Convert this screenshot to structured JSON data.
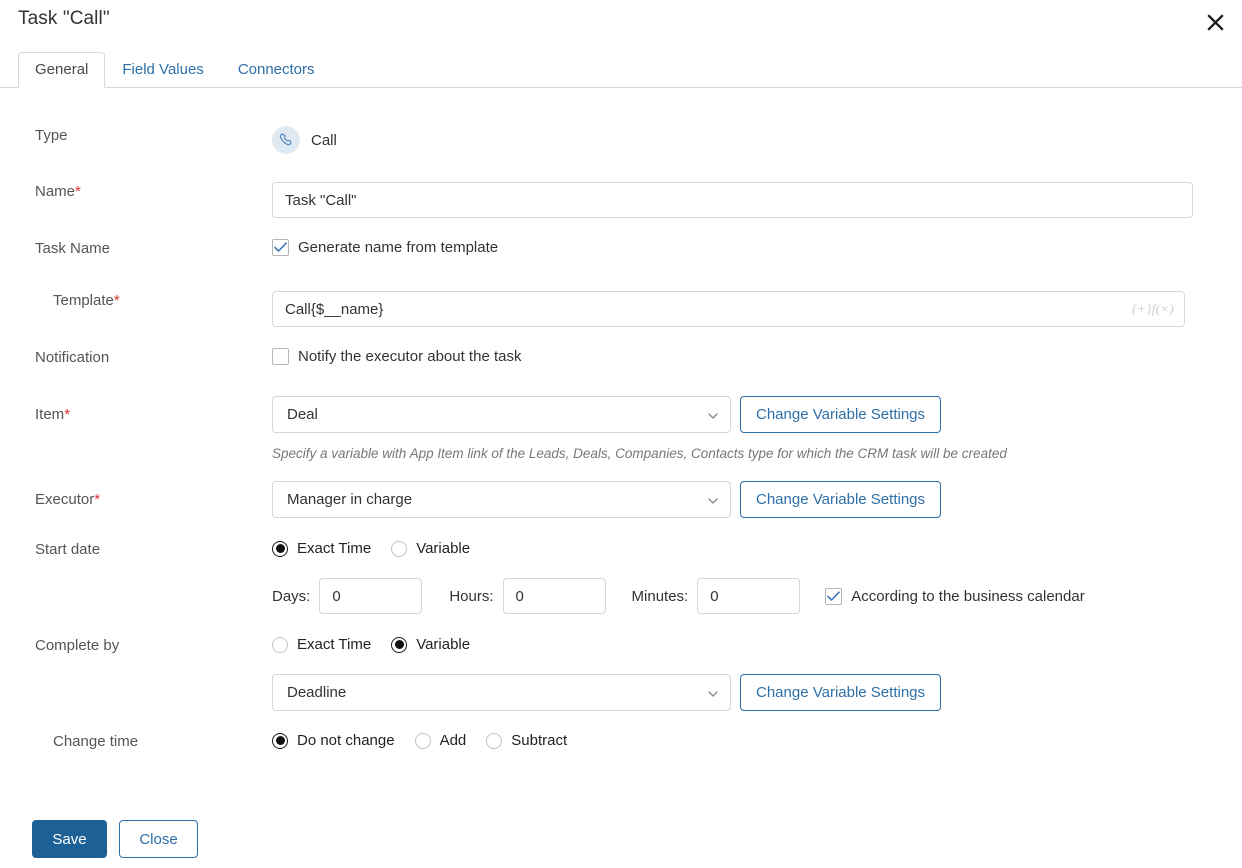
{
  "dialog": {
    "title": "Task \"Call\"",
    "close_icon": "close-icon"
  },
  "tabs": [
    {
      "label": "General",
      "active": true
    },
    {
      "label": "Field Values",
      "active": false
    },
    {
      "label": "Connectors",
      "active": false
    }
  ],
  "form": {
    "type": {
      "label": "Type",
      "icon": "phone-call-icon",
      "value": "Call"
    },
    "name": {
      "label": "Name",
      "required": "*",
      "value": "Task \"Call\"",
      "placeholder": ""
    },
    "task_name": {
      "label": "Task Name",
      "checkbox_label": "Generate name from template",
      "checked": true
    },
    "template": {
      "label": "Template",
      "required": "*",
      "value": "Call{$__name}",
      "fx_badge": "{+}f(×)"
    },
    "notification": {
      "label": "Notification",
      "checkbox_label": "Notify the executor about the task",
      "checked": false
    },
    "item": {
      "label": "Item",
      "required": "*",
      "selected": "Deal",
      "button_label": "Change Variable Settings",
      "hint": "Specify a variable with App Item link of the Leads, Deals, Companies, Contacts type for which the CRM task will be created"
    },
    "executor": {
      "label": "Executor",
      "required": "*",
      "selected": "Manager in charge",
      "button_label": "Change Variable Settings"
    },
    "start_date": {
      "label": "Start date",
      "options": [
        {
          "label": "Exact Time",
          "selected": true
        },
        {
          "label": "Variable",
          "selected": false
        }
      ],
      "days_label": "Days:",
      "days_value": "0",
      "hours_label": "Hours:",
      "hours_value": "0",
      "minutes_label": "Minutes:",
      "minutes_value": "0",
      "business_calendar_label": "According to the business calendar",
      "business_calendar_checked": true
    },
    "complete_by": {
      "label": "Complete by",
      "options": [
        {
          "label": "Exact Time",
          "selected": false
        },
        {
          "label": "Variable",
          "selected": true
        }
      ],
      "selected": "Deadline",
      "button_label": "Change Variable Settings"
    },
    "change_time": {
      "label": "Change time",
      "options": [
        {
          "label": "Do not change",
          "selected": true
        },
        {
          "label": "Add",
          "selected": false
        },
        {
          "label": "Subtract",
          "selected": false
        }
      ]
    }
  },
  "footer": {
    "save_label": "Save",
    "close_label": "Close"
  },
  "colors": {
    "accent_blue": "#2f6fa8",
    "primary_button": "#1d6095",
    "required_red": "#e03131",
    "icon_bg": "#dfe9f2"
  }
}
